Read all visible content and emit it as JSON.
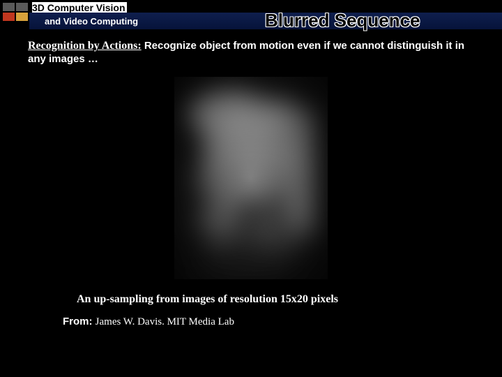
{
  "logo_colors": {
    "tl": "#5a5a5a",
    "tr": "#5a5a5a",
    "bl": "#c1371f",
    "br": "#d8a23b"
  },
  "header": {
    "course_line1": "3D Computer Vision",
    "course_line2": "and Video Computing",
    "slide_title": "Blurred Sequence"
  },
  "body": {
    "lead": "Recognition by Actions:",
    "rest": "Recognize object from motion even if we cannot distinguish it in any images …"
  },
  "caption": "An up-sampling from images of resolution 15x20 pixels",
  "from": {
    "label": "From:",
    "value": "James W. Davis. MIT Media Lab"
  }
}
